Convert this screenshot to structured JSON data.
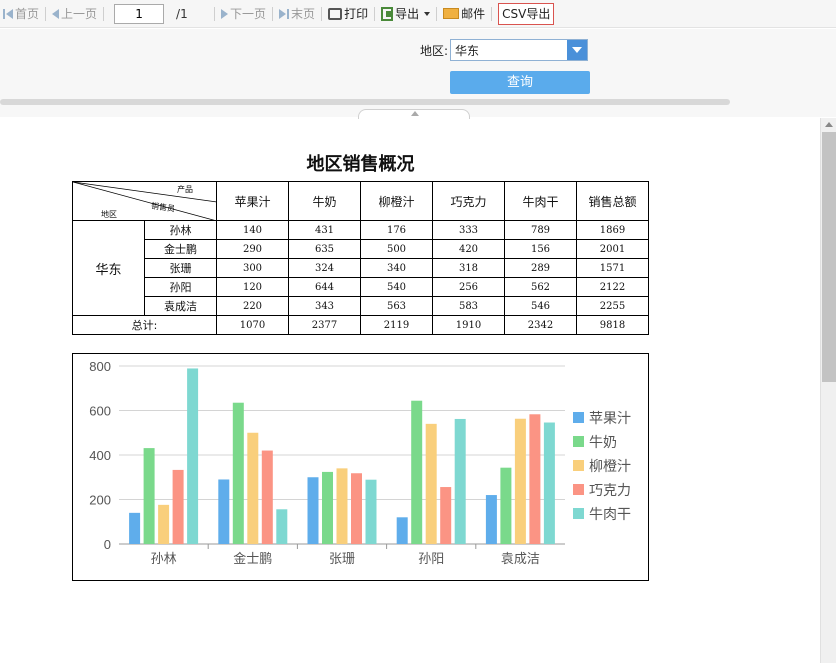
{
  "toolbar": {
    "first_label": "首页",
    "prev_label": "上一页",
    "page_value": "1",
    "page_total": "/1",
    "next_label": "下一页",
    "last_label": "末页",
    "print_label": "打印",
    "export_label": "导出",
    "mail_label": "邮件",
    "csv_label": "CSV导出"
  },
  "filter": {
    "region_label": "地区:",
    "region_value": "华东",
    "query_label": "查询"
  },
  "report": {
    "title": "地区销售概况",
    "corner_product": "产品",
    "corner_salesperson": "销售员",
    "corner_region": "地区",
    "columns": [
      "苹果汁",
      "牛奶",
      "柳橙汁",
      "巧克力",
      "牛肉干",
      "销售总额"
    ],
    "region": "华东",
    "rows": [
      {
        "name": "孙林",
        "values": [
          "140",
          "431",
          "176",
          "333",
          "789",
          "1869"
        ]
      },
      {
        "name": "金士鹏",
        "values": [
          "290",
          "635",
          "500",
          "420",
          "156",
          "2001"
        ]
      },
      {
        "name": "张珊",
        "values": [
          "300",
          "324",
          "340",
          "318",
          "289",
          "1571"
        ]
      },
      {
        "name": "孙阳",
        "values": [
          "120",
          "644",
          "540",
          "256",
          "562",
          "2122"
        ]
      },
      {
        "name": "袁成洁",
        "values": [
          "220",
          "343",
          "563",
          "583",
          "546",
          "2255"
        ]
      }
    ],
    "total_label": "总计:",
    "totals": [
      "1070",
      "2377",
      "2119",
      "1910",
      "2342",
      "9818"
    ]
  },
  "chart_data": {
    "type": "bar",
    "categories": [
      "孙林",
      "金士鹏",
      "张珊",
      "孙阳",
      "袁成洁"
    ],
    "series": [
      {
        "name": "苹果汁",
        "color": "#5fadeb",
        "values": [
          140,
          290,
          300,
          120,
          220
        ]
      },
      {
        "name": "牛奶",
        "color": "#7ad98b",
        "values": [
          431,
          635,
          324,
          644,
          343
        ]
      },
      {
        "name": "柳橙汁",
        "color": "#f9cf7c",
        "values": [
          176,
          500,
          340,
          540,
          563
        ]
      },
      {
        "name": "巧克力",
        "color": "#fb9484",
        "values": [
          333,
          420,
          318,
          256,
          583
        ]
      },
      {
        "name": "牛肉干",
        "color": "#7ed8d1",
        "values": [
          789,
          156,
          289,
          562,
          546
        ]
      }
    ],
    "yticks": [
      "0",
      "200",
      "400",
      "600",
      "800"
    ],
    "ylim": [
      0,
      800
    ],
    "grid": true,
    "legend_position": "right"
  }
}
